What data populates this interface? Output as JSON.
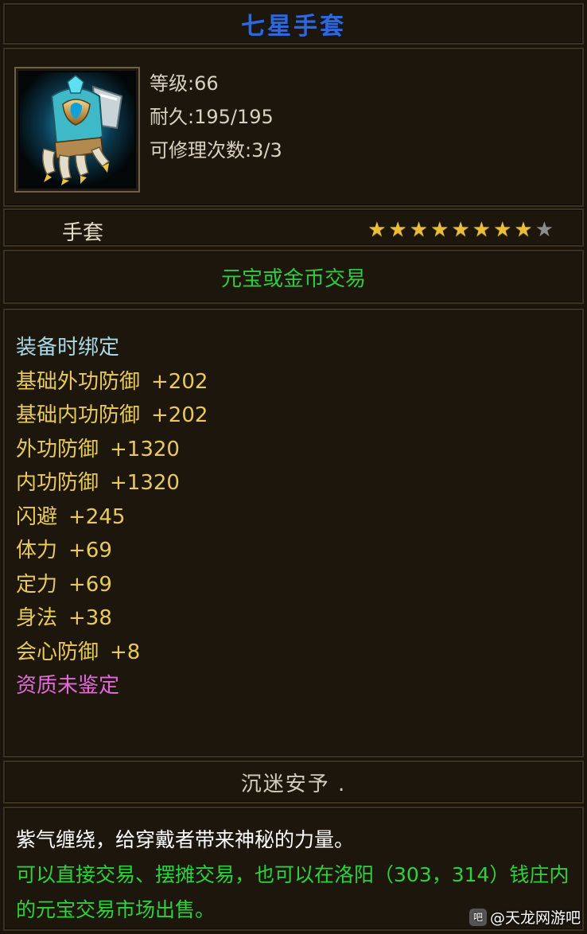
{
  "item": {
    "name": "七星手套",
    "stats": {
      "level": "等级:66",
      "durability": "耐久:195/195",
      "repair": "可修理次数:3/3"
    },
    "type": "手套",
    "stars": {
      "lit": 8,
      "total": 9
    },
    "trade": "元宝或金币交易",
    "attributes": {
      "bind": "装备时绑定",
      "lines": [
        {
          "name": "基础外功防御",
          "value": "+202"
        },
        {
          "name": "基础内功防御",
          "value": "+202"
        },
        {
          "name": "外功防御",
          "value": "+1320"
        },
        {
          "name": "内功防御",
          "value": "+1320"
        },
        {
          "name": "闪避",
          "value": "+245"
        },
        {
          "name": "体力",
          "value": "+69"
        },
        {
          "name": "定力",
          "value": "+69"
        },
        {
          "name": "身法",
          "value": "+38"
        },
        {
          "name": "会心防御",
          "value": "+8"
        }
      ],
      "aptitude": "资质未鉴定"
    },
    "crafter": "沉迷安予 .",
    "description": {
      "lore": "紫气缠绕，给穿戴者带来神秘的力量。",
      "trade_info": "可以直接交易、摆摊交易，也可以在洛阳（303，314）钱庄内的元宝交易市场出售。"
    }
  },
  "watermark": {
    "logo": "吧",
    "text": "@天龙网游吧"
  },
  "colors": {
    "title": "#2f68d8",
    "stat_text": "#d8d2c0",
    "trade": "#2ccc3c",
    "bind": "#a8d8e4",
    "attribute": "#e8ca5c",
    "aptitude": "#e26ad8",
    "star_lit": "#e8be3c",
    "star_dim": "#8c8c8c"
  },
  "icons": {
    "item_icon": "gauntlet-icon",
    "star": "star-icon"
  }
}
